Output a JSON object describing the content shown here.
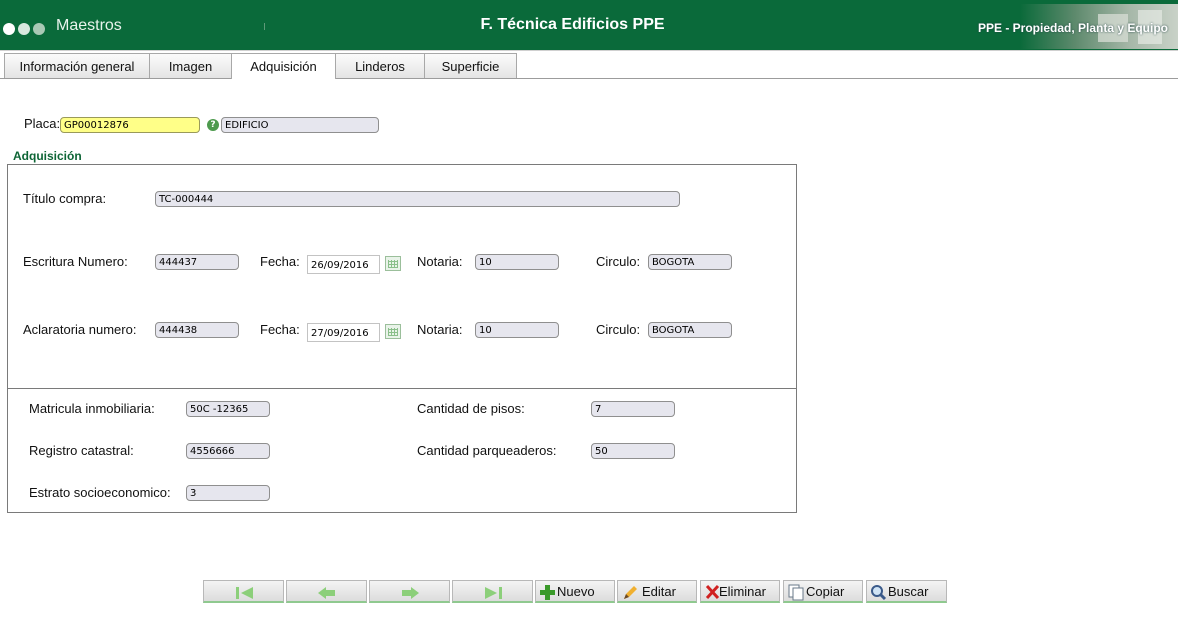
{
  "header": {
    "app_name": "Maestros",
    "title": "F. Técnica Edificios PPE",
    "module": "PPE - Propiedad, Planta y Equipo"
  },
  "tabs": [
    {
      "label": "Información general"
    },
    {
      "label": "Imagen"
    },
    {
      "label": "Adquisición",
      "active": true
    },
    {
      "label": "Linderos"
    },
    {
      "label": "Superficie"
    }
  ],
  "placa": {
    "label": "Placa:",
    "value": "GP00012876",
    "description": "EDIFICIO"
  },
  "section_title": "Adquisición",
  "adquisicion": {
    "titulo_compra_label": "Título compra:",
    "titulo_compra": "TC-000444",
    "escritura_label": "Escritura Numero:",
    "escritura": "444437",
    "fecha_label": "Fecha:",
    "escritura_fecha": "26/09/2016",
    "notaria_label": "Notaria:",
    "escritura_notaria": "10",
    "circulo_label": "Circulo:",
    "escritura_circulo": "BOGOTA",
    "aclaratoria_label": "Aclaratoria numero:",
    "aclaratoria": "444438",
    "aclaratoria_fecha": "27/09/2016",
    "aclaratoria_notaria": "10",
    "aclaratoria_circulo": "BOGOTA"
  },
  "detalles": {
    "matricula_label": "Matricula inmobiliaria:",
    "matricula": "50C -12365",
    "pisos_label": "Cantidad de pisos:",
    "pisos": "7",
    "registro_label": "Registro catastral:",
    "registro": "4556666",
    "parqueaderos_label": "Cantidad parqueaderos:",
    "parqueaderos": "50",
    "estrato_label": "Estrato socioeconomico:",
    "estrato": "3"
  },
  "toolbar": {
    "nuevo": "Nuevo",
    "editar": "Editar",
    "eliminar": "Eliminar",
    "copiar": "Copiar",
    "buscar": "Buscar"
  },
  "icons": {
    "first": "first-record-icon",
    "prev": "previous-record-icon",
    "next": "next-record-icon",
    "last": "last-record-icon",
    "nuevo": "plus-icon",
    "editar": "pencil-icon",
    "eliminar": "x-icon",
    "copiar": "copy-icon",
    "buscar": "magnifier-icon",
    "help": "help-icon",
    "calendar": "calendar-icon"
  },
  "colors": {
    "header_bg": "#0a6a3a",
    "placa_highlight": "#ffff88",
    "section_title": "#0d6535",
    "nav_arrow": "#8ccf7a"
  }
}
